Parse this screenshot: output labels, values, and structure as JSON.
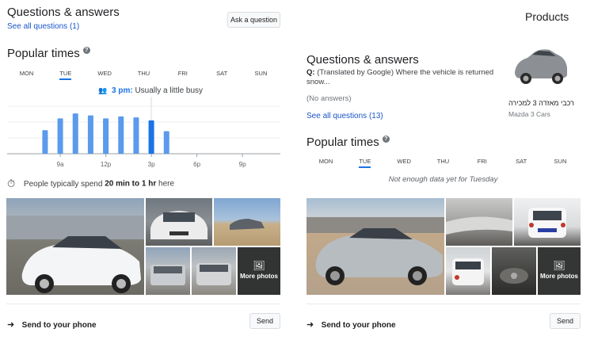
{
  "left": {
    "qa": {
      "title": "Questions & answers",
      "see_all": "See all questions (1)",
      "ask_button": "Ask a question"
    },
    "popular": {
      "title": "Popular times",
      "days": [
        "MON",
        "TUE",
        "WED",
        "THU",
        "FRI",
        "SAT",
        "SUN"
      ],
      "selected_day": "TUE",
      "tooltip_time": "3 pm:",
      "tooltip_text": "Usually a little busy",
      "x_ticks": [
        "9a",
        "12p",
        "3p",
        "6p",
        "9p"
      ],
      "bars": [
        0.48,
        0.72,
        0.82,
        0.78,
        0.72,
        0.76,
        0.74,
        0.68,
        0.46
      ],
      "highlight_index": 7,
      "accent_color": "#1a73e8",
      "bar_color": "#5b9aec"
    },
    "visit": {
      "prefix": "People typically spend",
      "duration": "20 min to 1 hr",
      "suffix": "here"
    },
    "photos": {
      "more_label": "More photos"
    },
    "send": {
      "label": "Send to your phone",
      "button": "Send"
    }
  },
  "right": {
    "products_title": "Products",
    "qa": {
      "title": "Questions & answers",
      "q_prefix": "Q:",
      "question": "(Translated by Google) Where the vehicle is returned snow...",
      "no_answers": "(No answers)",
      "see_all": "See all questions (13)"
    },
    "product": {
      "name": "רכבי מאזדה 3 למכירה",
      "subtitle": "Mazda 3 Cars"
    },
    "popular": {
      "title": "Popular times",
      "days": [
        "MON",
        "TUE",
        "WED",
        "THU",
        "FRI",
        "SAT",
        "SUN"
      ],
      "selected_day": "TUE",
      "no_data": "Not enough data yet for Tuesday"
    },
    "photos": {
      "more_label": "More photos"
    },
    "send": {
      "label": "Send to your phone",
      "button": "Send"
    }
  }
}
